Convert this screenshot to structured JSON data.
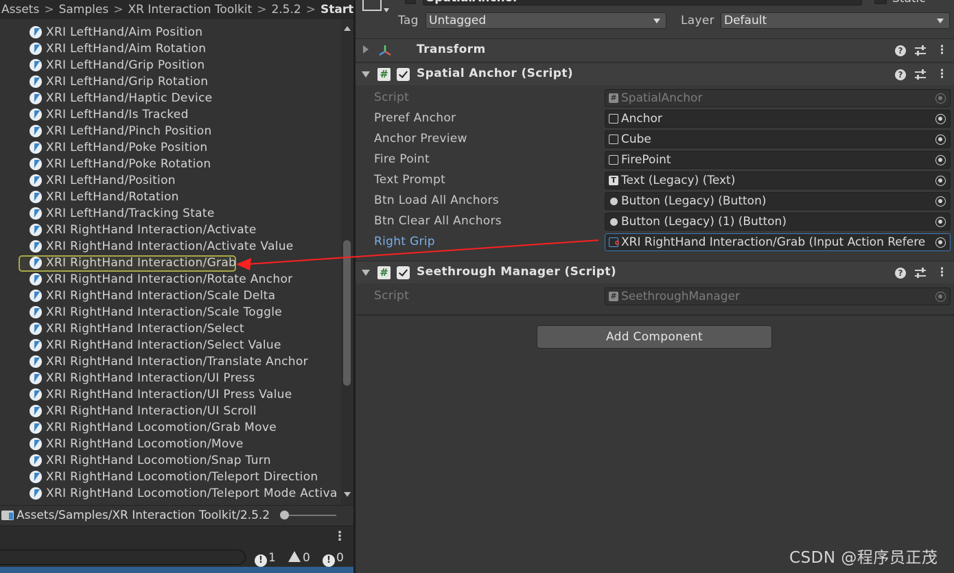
{
  "project": {
    "breadcrumb": [
      "Assets",
      "Samples",
      "XR Interaction Toolkit",
      "2.5.2",
      "Start"
    ],
    "assets": [
      "XRI LeftHand/Aim Position",
      "XRI LeftHand/Aim Rotation",
      "XRI LeftHand/Grip Position",
      "XRI LeftHand/Grip Rotation",
      "XRI LeftHand/Haptic Device",
      "XRI LeftHand/Is Tracked",
      "XRI LeftHand/Pinch Position",
      "XRI LeftHand/Poke Position",
      "XRI LeftHand/Poke Rotation",
      "XRI LeftHand/Position",
      "XRI LeftHand/Rotation",
      "XRI LeftHand/Tracking State",
      "XRI RightHand Interaction/Activate",
      "XRI RightHand Interaction/Activate Value",
      "XRI RightHand Interaction/Grab",
      "XRI RightHand Interaction/Rotate Anchor",
      "XRI RightHand Interaction/Scale Delta",
      "XRI RightHand Interaction/Scale Toggle",
      "XRI RightHand Interaction/Select",
      "XRI RightHand Interaction/Select Value",
      "XRI RightHand Interaction/Translate Anchor",
      "XRI RightHand Interaction/UI Press",
      "XRI RightHand Interaction/UI Press Value",
      "XRI RightHand Interaction/UI Scroll",
      "XRI RightHand Locomotion/Grab Move",
      "XRI RightHand Locomotion/Move",
      "XRI RightHand Locomotion/Snap Turn",
      "XRI RightHand Locomotion/Teleport Direction",
      "XRI RightHand Locomotion/Teleport Mode Activa"
    ],
    "selected_index": 14,
    "path": "Assets/Samples/XR Interaction Toolkit/2.5.2",
    "console_counts": {
      "log": "1",
      "warning": "0",
      "error": "0"
    }
  },
  "inspector": {
    "object_name": "SpatialAnchor",
    "static_label": "Static",
    "tag_label": "Tag",
    "tag_value": "Untagged",
    "layer_label": "Layer",
    "layer_value": "Default",
    "components": {
      "transform": {
        "title": "Transform"
      },
      "spatial_anchor": {
        "title": "Spatial Anchor (Script)",
        "props": [
          {
            "label": "Script",
            "value": "SpatialAnchor",
            "icon": "script-icon",
            "disabled": true
          },
          {
            "label": "Preref Anchor",
            "value": "Anchor",
            "icon": "prefab-icon"
          },
          {
            "label": "Anchor Preview",
            "value": "Cube",
            "icon": "prefab-icon"
          },
          {
            "label": "Fire Point",
            "value": "FirePoint",
            "icon": "prefab-icon"
          },
          {
            "label": "Text Prompt",
            "value": "Text (Legacy) (Text)",
            "icon": "text-icon"
          },
          {
            "label": "Btn Load All Anchors",
            "value": "Button (Legacy) (Button)",
            "icon": "button-icon"
          },
          {
            "label": "Btn Clear All Anchors",
            "value": "Button (Legacy) (1) (Button)",
            "icon": "button-icon"
          },
          {
            "label": "Right Grip",
            "value": "XRI RightHand Interaction/Grab (Input Action Refere",
            "icon": "input-action-icon",
            "highlight": true
          }
        ]
      },
      "seethrough": {
        "title": "Seethrough Manager (Script)",
        "props": [
          {
            "label": "Script",
            "value": "SeethroughManager",
            "icon": "script-icon",
            "disabled": true
          }
        ]
      }
    },
    "add_component_label": "Add Component"
  },
  "watermark": "CSDN @程序员正茂",
  "colors": {
    "annotation_arrow": "#ff2020",
    "selection_outline": "#a8a84a",
    "highlight_label": "#7aaee8"
  }
}
